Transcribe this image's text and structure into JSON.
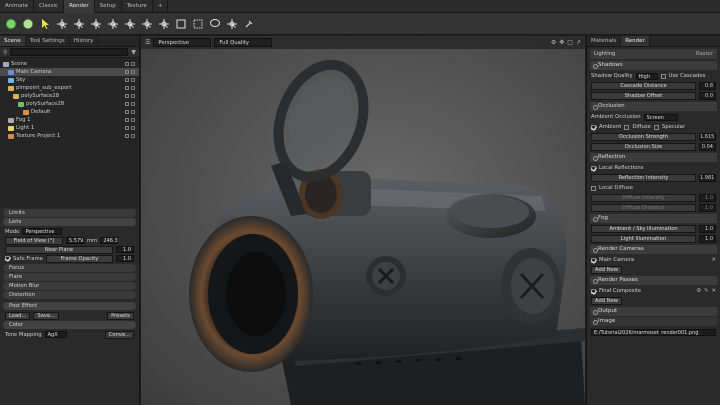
{
  "app_tabs": [
    "Animate",
    "Classic",
    "Render",
    "Setup",
    "Texture",
    "+"
  ],
  "active_app_tab": 2,
  "toolbar_icons": [
    "sphere-icon",
    "sphere-light-icon",
    "cursor-icon",
    "move-icon",
    "rotate-icon",
    "scale-icon",
    "camera-icon",
    "light-icon",
    "transform-icon",
    "mesh-icon",
    "box-icon",
    "rect-select-icon",
    "lasso-icon",
    "paint-select-icon",
    "pin-icon"
  ],
  "left_panel": {
    "tabs": [
      "Scene",
      "Tool Settings",
      "History"
    ],
    "tree": [
      {
        "label": "Scene",
        "depth": 0,
        "icon": "scene-icon",
        "color": "#9aa9c9"
      },
      {
        "label": "Main Camera",
        "depth": 1,
        "icon": "camera-icon",
        "color": "#6c8fd4",
        "selected": true
      },
      {
        "label": "Sky",
        "depth": 1,
        "icon": "sky-icon",
        "color": "#6fb6e8"
      },
      {
        "label": "pimpoint_sub_export",
        "depth": 1,
        "icon": "mesh-icon",
        "color": "#d6b35a"
      },
      {
        "label": "polySurface28",
        "depth": 2,
        "icon": "mesh-icon",
        "color": "#d6b35a"
      },
      {
        "label": "polySurface28",
        "depth": 3,
        "icon": "mesh-icon",
        "color": "#6cc06c"
      },
      {
        "label": "Default",
        "depth": 4,
        "icon": "material-icon",
        "color": "#d69050"
      },
      {
        "label": "Fog 1",
        "depth": 1,
        "icon": "fog-icon",
        "color": "#aaaaaa"
      },
      {
        "label": "Light 1",
        "depth": 1,
        "icon": "light-icon",
        "color": "#e8d35a"
      },
      {
        "label": "Texture Project 1",
        "depth": 1,
        "icon": "texture-icon",
        "color": "#d08a50"
      }
    ],
    "sections": {
      "limits": "Limits",
      "lens": "Lens",
      "focus": "Focus",
      "flare": "Flare",
      "motion_blur": "Motion Blur",
      "distortion": "Distortion",
      "post_effect": "Post Effect",
      "color": "Color"
    },
    "lens": {
      "mode_label": "Mode",
      "mode_value": "Perspective",
      "fov_label": "Field of View (°)",
      "fov_value": "5.579",
      "mm_label": "mm",
      "mm_value": "246.3",
      "near_plane_label": "Near Plane",
      "near_plane_value": "1.0",
      "safe_frame_label": "Safe Frame",
      "frame_opacity_label": "Frame Opacity",
      "frame_opacity_value": "1.0"
    },
    "post": {
      "load": "Load...",
      "save": "Save...",
      "presets": "Presets"
    },
    "color": {
      "tone_mapping_label": "Tone Mapping",
      "tone_mapping_value": "AgX",
      "convert": "Conve..."
    }
  },
  "viewport": {
    "camera_mode": "Perspective",
    "quality": "Full Quality"
  },
  "right_panel": {
    "tabs": [
      "Materials",
      "Render"
    ],
    "lighting_label": "Lighting",
    "lighting_mode": "Raster",
    "shadows": {
      "title": "Shadows",
      "quality_label": "Shadow Quality",
      "quality_value": "High",
      "use_cascades": "Use Cascades",
      "cascade_distance_label": "Cascade Distance",
      "cascade_distance_value": "0.8",
      "shadow_offset_label": "Shadow Offset",
      "shadow_offset_value": "0.0"
    },
    "occlusion": {
      "title": "Occlusion",
      "ao_label": "Ambient Occlusion",
      "ao_value": "Screen",
      "ambient": "Ambient",
      "diffuse": "Diffuse",
      "specular": "Specular",
      "strength_label": "Occlusion Strength",
      "strength_value": "1.615",
      "size_label": "Occlusion Size",
      "size_value": "0.04"
    },
    "reflection": {
      "title": "Reflection",
      "local_reflections": "Local Reflections",
      "intensity_label": "Reflection Intensity",
      "intensity_value": "1.981",
      "local_diffuse": "Local Diffuse",
      "diffuse_intensity_label": "Diffuse Intensity",
      "diffuse_intensity_value": "1.0",
      "diffuse_distance_label": "Diffuse Distance",
      "diffuse_distance_value": "1.0"
    },
    "fog": {
      "title": "Fog",
      "ambient_label": "Ambient / Sky Illumination",
      "ambient_value": "1.0",
      "light_label": "Light Illumination",
      "light_value": "1.0"
    },
    "render_cameras": {
      "title": "Render Cameras",
      "item": "Main Camera",
      "add": "Add New"
    },
    "render_passes": {
      "title": "Render Passes",
      "item": "Final Composite",
      "add": "Add New"
    },
    "output": {
      "title": "Output",
      "image_label": "Image",
      "path": "E:/Tutorial2026/marmoset_render001.png"
    }
  }
}
